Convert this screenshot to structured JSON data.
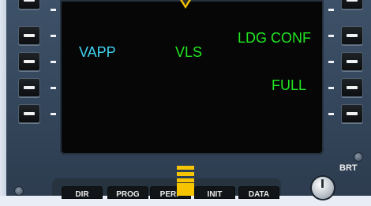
{
  "screen": {
    "labels": {
      "vapp": "VAPP",
      "vls": "VLS",
      "ldg_conf": "LDG CONF",
      "full": "FULL"
    }
  },
  "keys": {
    "dir": "DIR",
    "prog": "PROG",
    "perf": "PERF",
    "init": "INIT",
    "data": "DATA"
  },
  "brightness": {
    "label": "BRT"
  },
  "colors": {
    "cyan_text": "#3fd3f0",
    "green_text": "#22e622",
    "bezel": "#3d5168",
    "screen_bg": "#060606",
    "yellow_marker": "#f6c400"
  },
  "icons": {
    "lsk": "line-select-key",
    "cursor": "triangle-marker-icon",
    "knob": "brightness-knob-icon"
  }
}
